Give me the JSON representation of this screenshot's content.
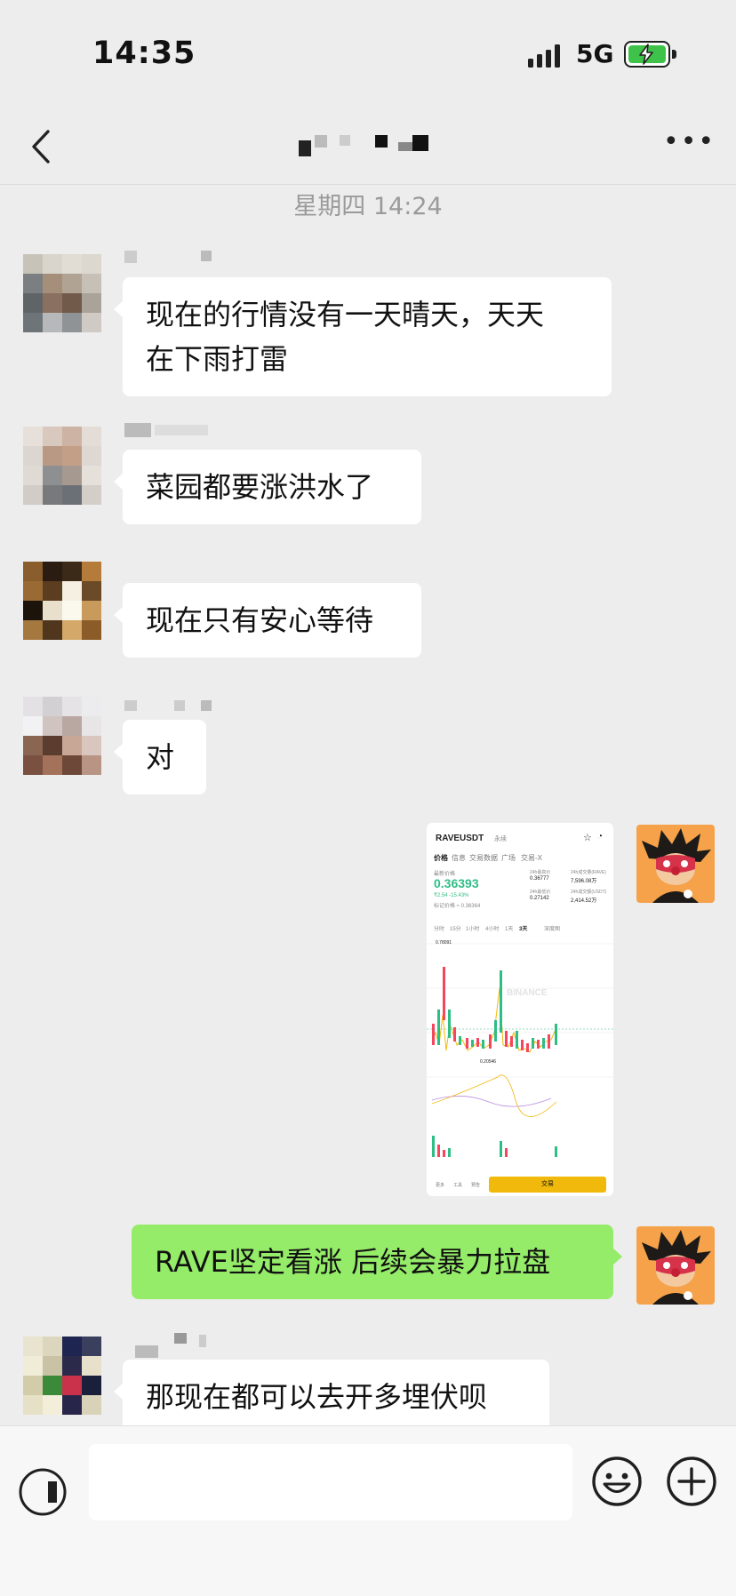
{
  "status_bar": {
    "time": "14:35",
    "network": "5G"
  },
  "header": {
    "back_icon": "chevron-left-icon",
    "more_label": "•••"
  },
  "timestamp": "星期四 14:24",
  "messages": [
    {
      "side": "left",
      "text_line1": "现在的行情没有一天晴天，天天",
      "text_line2": "在下雨打雷"
    },
    {
      "side": "left",
      "text": "菜园都要涨洪水了"
    },
    {
      "side": "left",
      "text": "现在只有安心等待"
    },
    {
      "side": "left",
      "text": "对"
    },
    {
      "side": "right",
      "type": "image"
    },
    {
      "side": "right",
      "text": "RAVE坚定看涨 后续会暴力拉盘"
    },
    {
      "side": "left",
      "text": "那现在都可以去开多埋伏呗"
    }
  ],
  "shared_image": {
    "pair": "RAVEUSDT",
    "pair_tag": "永续",
    "tabs": [
      "价格",
      "信息",
      "交易数据",
      "广场",
      "交易-X"
    ],
    "last_price_label": "最新价格",
    "price": "0.36393",
    "change": "₹2.54 -15.43%",
    "mark_price": "标记价格 ≈ 0.36364",
    "high_label": "24h最高价",
    "high": "0.36777",
    "low_label": "24h最低价",
    "low": "0.27142",
    "vol1_label": "24h成交量(RAVE)",
    "vol1": "7,596.08万",
    "vol2_label": "24h成交额(USDT)",
    "vol2": "2,414.52万",
    "intervals": [
      "分时",
      "15分",
      "1小时",
      "4小时",
      "1天",
      "3天",
      "深度图"
    ],
    "peak": "0.78091",
    "low_mark": "0.20546",
    "watermark": "BINANCE",
    "trade_button": "交易",
    "bottom_nav": [
      "更多",
      "工具",
      "预告"
    ],
    "colors": {
      "up": "#2ebd85",
      "down": "#f6465d",
      "accent": "#f0b90b"
    }
  },
  "input_bar": {
    "voice_icon": "voice-icon",
    "emoji_icon": "emoji-icon",
    "plus_icon": "plus-icon"
  },
  "colors": {
    "background": "#ededed",
    "my_bubble": "#95ec69",
    "their_bubble": "#ffffff"
  }
}
